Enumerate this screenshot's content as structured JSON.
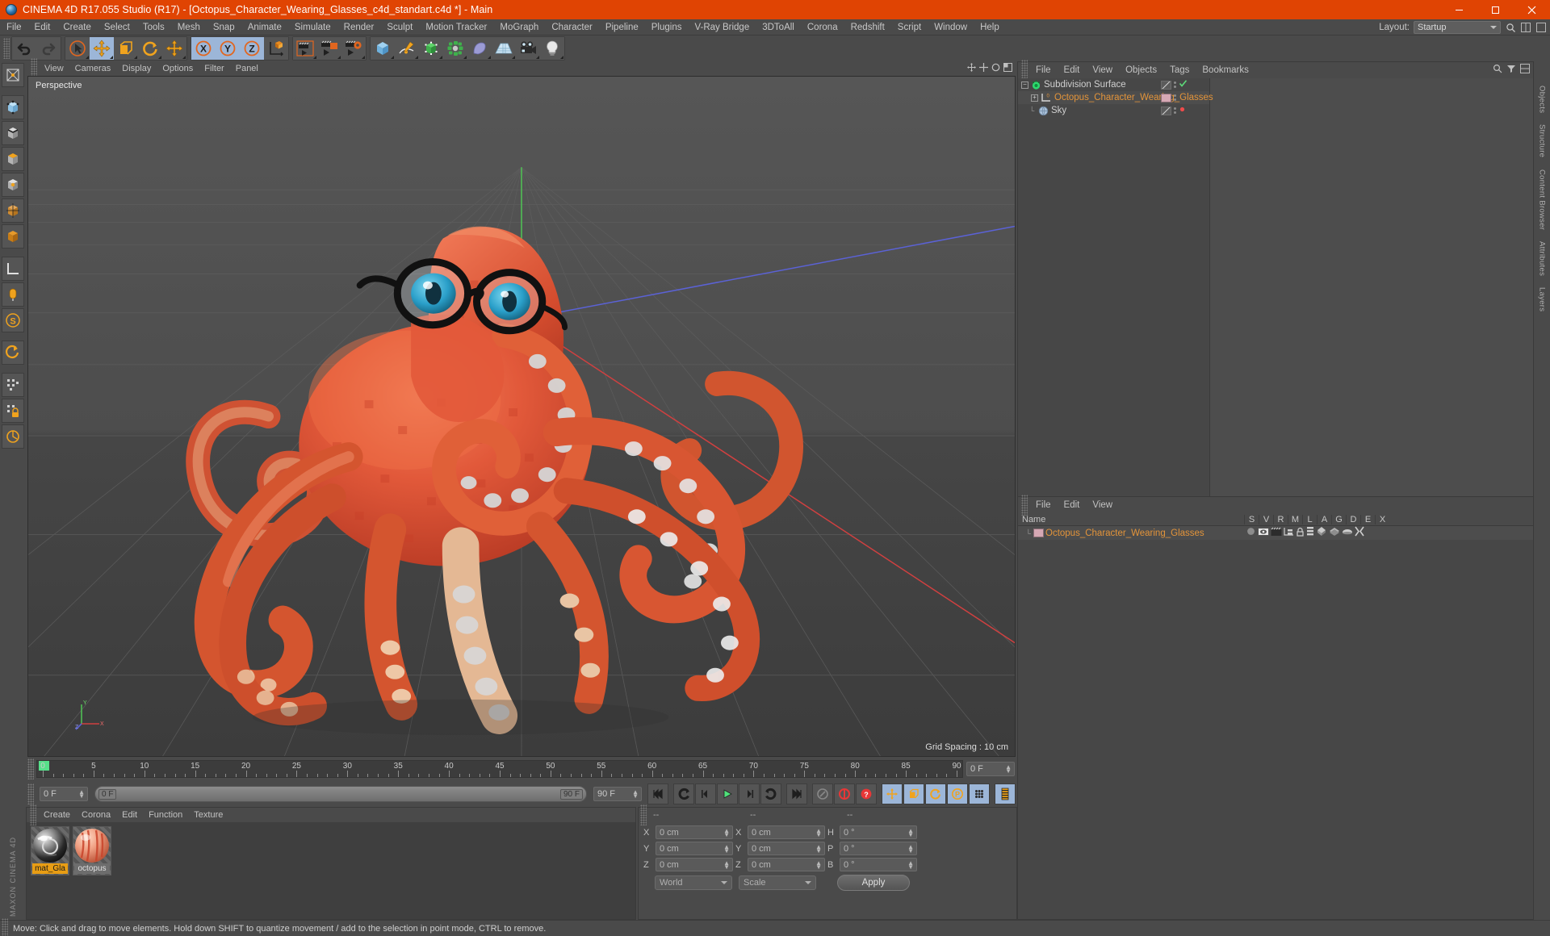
{
  "titlebar": {
    "title": "CINEMA 4D R17.055 Studio (R17) - [Octopus_Character_Wearing_Glasses_c4d_standart.c4d *] - Main",
    "minimize": "minimize-icon",
    "maximize": "maximize-icon",
    "close": "close-icon"
  },
  "menubar": {
    "items": [
      "File",
      "Edit",
      "Create",
      "Select",
      "Tools",
      "Mesh",
      "Snap",
      "Animate",
      "Simulate",
      "Render",
      "Sculpt",
      "Motion Tracker",
      "MoGraph",
      "Character",
      "Pipeline",
      "Plugins",
      "V-Ray Bridge",
      "3DToAll",
      "Corona",
      "Redshift",
      "Script",
      "Window",
      "Help"
    ],
    "layout_label": "Layout:",
    "layout_value": "Startup"
  },
  "toolbar": {
    "groups": [
      {
        "buttons": [
          {
            "name": "undo-button",
            "icon": "undo-arrow",
            "selected": false
          },
          {
            "name": "redo-button",
            "icon": "redo-arrow",
            "selected": false
          }
        ]
      },
      {
        "buttons": [
          {
            "name": "live-selection-tool",
            "icon": "cursor-circle",
            "selected": false
          },
          {
            "name": "move-tool",
            "icon": "move-cross",
            "selected": true
          },
          {
            "name": "scale-tool",
            "icon": "scale-square",
            "selected": false
          },
          {
            "name": "rotate-tool",
            "icon": "rotate-ring",
            "selected": false
          },
          {
            "name": "move-axis-tool",
            "icon": "move-cross",
            "selected": false
          }
        ]
      },
      {
        "buttons": [
          {
            "name": "x-axis-lock",
            "icon": "axis-x",
            "selected": true
          },
          {
            "name": "y-axis-lock",
            "icon": "axis-y",
            "selected": true
          },
          {
            "name": "z-axis-lock",
            "icon": "axis-z",
            "selected": true
          },
          {
            "name": "world-object-coord",
            "icon": "world-cube",
            "selected": false
          }
        ]
      },
      {
        "buttons": [
          {
            "name": "render-view-button",
            "icon": "clapper",
            "selected": false
          },
          {
            "name": "render-region-button",
            "icon": "clapper-region",
            "selected": false
          },
          {
            "name": "render-settings-button",
            "icon": "clapper-gear",
            "selected": false
          }
        ]
      },
      {
        "buttons": [
          {
            "name": "add-cube-button",
            "icon": "blue-cube",
            "selected": false
          },
          {
            "name": "add-spline-button",
            "icon": "pen-spline",
            "selected": false
          },
          {
            "name": "add-generator-button",
            "icon": "green-cube",
            "selected": false
          },
          {
            "name": "add-array-button",
            "icon": "green-cluster",
            "selected": false
          },
          {
            "name": "add-bend-deformer-button",
            "icon": "purple-bend",
            "selected": false
          },
          {
            "name": "add-floor-button",
            "icon": "grid-floor",
            "selected": false
          },
          {
            "name": "add-camera-button",
            "icon": "camera",
            "selected": false
          },
          {
            "name": "add-light-button",
            "icon": "light-bulb",
            "selected": false
          }
        ]
      }
    ]
  },
  "left_rail": {
    "buttons": [
      {
        "name": "texture-axis-tool",
        "icon": "texture-axis"
      },
      {
        "name": "point-mode-button",
        "icon": "point-cube"
      },
      {
        "name": "edge-mode-button",
        "icon": "edge-cube"
      },
      {
        "name": "polygon-mode-button",
        "icon": "polygon-cube"
      },
      {
        "name": "model-mode-button",
        "icon": "model-cube"
      },
      {
        "name": "object-axis-mode-button",
        "icon": "axis-cube"
      },
      {
        "name": "texture-mode-button",
        "icon": "texture-cube"
      },
      {
        "name": "workplane-button",
        "icon": "workplane"
      },
      {
        "name": "enable-axis-button",
        "icon": "axis-modify"
      },
      {
        "name": "snap-settings-button",
        "icon": "snap-s"
      },
      {
        "name": "viewport-solo-button",
        "icon": "solo-arrow"
      },
      {
        "name": "quantize-button",
        "icon": "quantize-grid"
      },
      {
        "name": "lock-workplane-button",
        "icon": "lock-padlock"
      },
      {
        "name": "workplane-mode-button",
        "icon": "workplane-circle"
      }
    ],
    "brand": "MAXON CINEMA 4D"
  },
  "viewport": {
    "menus": [
      "View",
      "Cameras",
      "Display",
      "Options",
      "Filter",
      "Panel"
    ],
    "label": "Perspective",
    "grid_info": "Grid Spacing : 10 cm",
    "nav_icons": [
      "move-view-icon",
      "scale-view-icon",
      "rotate-view-icon",
      "maximize-view-icon"
    ],
    "axis_gizmo": {
      "x": "X",
      "y": "Y",
      "z": "Z"
    },
    "scene": "octopus-character-wearing-glasses-3d-model"
  },
  "timeline": {
    "ruler_min": 0,
    "ruler_max": 90,
    "labels": [
      0,
      5,
      10,
      15,
      20,
      25,
      30,
      35,
      40,
      45,
      50,
      55,
      60,
      65,
      70,
      75,
      80,
      85,
      90
    ],
    "playhead_frame": 0,
    "current_frame_field": "0 F",
    "end_frame_field": "90 F",
    "scrub_start": "0 F",
    "scrub_end": "90 F",
    "right_frame_field": "0 F",
    "transport": [
      {
        "name": "go-to-start-button",
        "icon": "skip-back"
      },
      {
        "name": "previous-key-button",
        "icon": "rewind-key"
      },
      {
        "name": "previous-frame-button",
        "icon": "step-back"
      },
      {
        "name": "play-button",
        "icon": "play-triangle"
      },
      {
        "name": "next-frame-button",
        "icon": "step-forward"
      },
      {
        "name": "next-key-button",
        "icon": "forward-key"
      },
      {
        "name": "go-to-end-button",
        "icon": "skip-forward"
      }
    ],
    "record_group": [
      {
        "name": "autokey-button",
        "icon": "key-gray"
      },
      {
        "name": "record-active-objects-button",
        "icon": "record-red"
      },
      {
        "name": "record-question-button",
        "icon": "record-question"
      }
    ],
    "key_group": [
      {
        "name": "position-key-button",
        "icon": "move-cross-orange"
      },
      {
        "name": "scale-key-button",
        "icon": "scale-orange"
      },
      {
        "name": "rotation-key-button",
        "icon": "rotate-orange"
      },
      {
        "name": "param-key-button",
        "icon": "param-p"
      },
      {
        "name": "pla-key-button",
        "icon": "dots-grid"
      }
    ],
    "timeline_button": {
      "name": "open-timeline-button",
      "icon": "film-strip"
    }
  },
  "material_manager": {
    "menus": [
      "Create",
      "Corona",
      "Edit",
      "Function",
      "Texture"
    ],
    "materials": [
      {
        "name": "mat_Gla",
        "selected": true,
        "swatch": "glass"
      },
      {
        "name": "octopus",
        "selected": false,
        "swatch": "octopus"
      }
    ]
  },
  "coordinates": {
    "headers": [
      "--",
      "--",
      "--"
    ],
    "rows": [
      {
        "pos_label": "X",
        "pos_value": "0 cm",
        "size_label": "X",
        "size_value": "0 cm",
        "rot_label": "H",
        "rot_value": "0 °"
      },
      {
        "pos_label": "Y",
        "pos_value": "0 cm",
        "size_label": "Y",
        "size_value": "0 cm",
        "rot_label": "P",
        "rot_value": "0 °"
      },
      {
        "pos_label": "Z",
        "pos_value": "0 cm",
        "size_label": "Z",
        "size_value": "0 cm",
        "rot_label": "B",
        "rot_value": "0 °"
      }
    ],
    "coord_system": "World",
    "mode": "Scale",
    "apply_label": "Apply"
  },
  "object_manager": {
    "menus": [
      "File",
      "Edit",
      "View",
      "Objects",
      "Tags",
      "Bookmarks"
    ],
    "items": [
      {
        "name": "Subdivision Surface",
        "indent": 0,
        "expanded": true,
        "icon": "subdivision-surface-icon",
        "tag_chip": "diag",
        "status": "check",
        "orange": false
      },
      {
        "name": "Octopus_Character_Wearing_Glasses",
        "indent": 1,
        "expanded": false,
        "icon": "null-object-icon",
        "tag_chip": "pink",
        "status": "none",
        "orange": true
      },
      {
        "name": "Sky",
        "indent": 1,
        "expanded": null,
        "icon": "sky-sphere-icon",
        "tag_chip": "diag",
        "status": "dot",
        "orange": false
      }
    ]
  },
  "attribute_manager": {
    "menus": [
      "File",
      "Edit",
      "View"
    ],
    "name_column": "Name",
    "columns": [
      "S",
      "V",
      "R",
      "M",
      "L",
      "A",
      "G",
      "D",
      "E",
      "X"
    ],
    "rows": [
      {
        "name": "Octopus_Character_Wearing_Glasses",
        "chip": "pink"
      }
    ]
  },
  "dock_tabs": [
    "Objects",
    "Structure",
    "Content Browser",
    "Attributes",
    "Layers"
  ],
  "statusbar": {
    "message": "Move: Click and drag to move elements. Hold down SHIFT to quantize movement / add to the selection in point mode, CTRL to remove."
  },
  "colors": {
    "accent_orange": "#e04403",
    "panel_bg": "#4a4a4a",
    "viewport_top": "#525252",
    "viewport_bottom": "#3f3f3f",
    "selected_blue": "#9cb6d8",
    "material_selected": "#e89d14",
    "orange_text": "#e3943a"
  }
}
